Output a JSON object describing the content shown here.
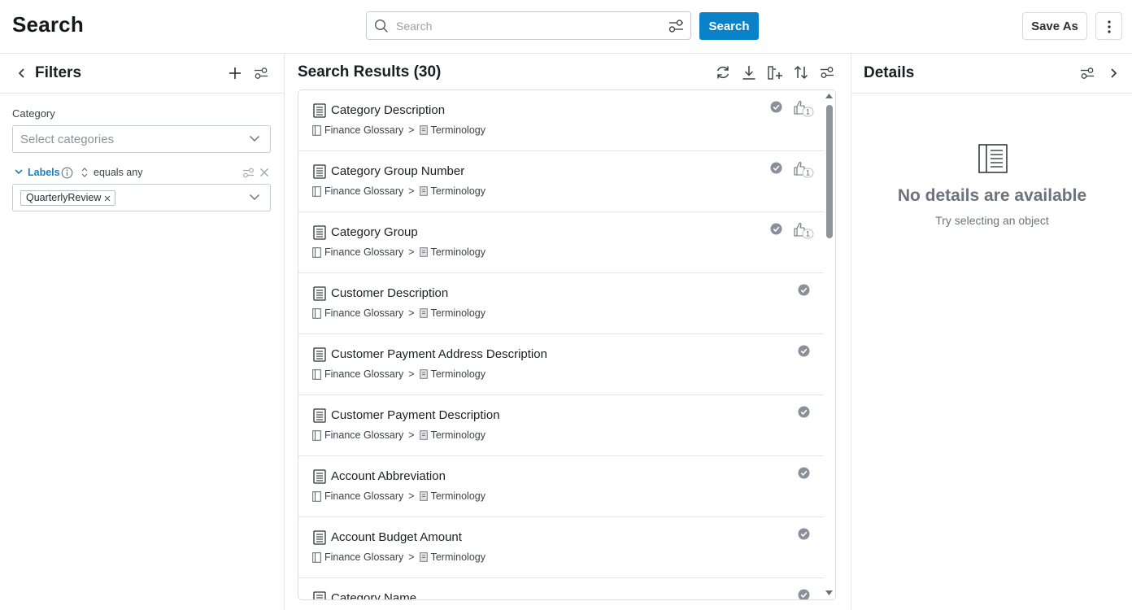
{
  "header": {
    "title": "Search",
    "search": {
      "placeholder": "Search",
      "value": ""
    },
    "search_button": "Search",
    "save_as_button": "Save As"
  },
  "filters": {
    "title": "Filters",
    "category": {
      "label": "Category",
      "placeholder": "Select categories"
    },
    "labels": {
      "label": "Labels",
      "operator": "equals any",
      "chips": [
        "QuarterlyReview"
      ]
    }
  },
  "results": {
    "title": "Search Results (30)",
    "items": [
      {
        "name": "Category Description",
        "glossary": "Finance Glossary",
        "separator": ">",
        "folder": "Terminology",
        "likes": "1"
      },
      {
        "name": "Category Group Number",
        "glossary": "Finance Glossary",
        "separator": ">",
        "folder": "Terminology",
        "likes": "1"
      },
      {
        "name": "Category Group",
        "glossary": "Finance Glossary",
        "separator": ">",
        "folder": "Terminology",
        "likes": "1"
      },
      {
        "name": "Customer Description",
        "glossary": "Finance Glossary",
        "separator": ">",
        "folder": "Terminology",
        "likes": ""
      },
      {
        "name": "Customer Payment Address Description",
        "glossary": "Finance Glossary",
        "separator": ">",
        "folder": "Terminology",
        "likes": ""
      },
      {
        "name": "Customer Payment Description",
        "glossary": "Finance Glossary",
        "separator": ">",
        "folder": "Terminology",
        "likes": ""
      },
      {
        "name": "Account Abbreviation",
        "glossary": "Finance Glossary",
        "separator": ">",
        "folder": "Terminology",
        "likes": ""
      },
      {
        "name": "Account Budget Amount",
        "glossary": "Finance Glossary",
        "separator": ">",
        "folder": "Terminology",
        "likes": ""
      },
      {
        "name": "Category Name",
        "glossary": "",
        "separator": "",
        "folder": "",
        "likes": ""
      }
    ]
  },
  "details": {
    "title": "Details",
    "empty_title": "No details are available",
    "empty_subtitle": "Try selecting an object"
  },
  "colors": {
    "accent": "#0a82c8",
    "verified": "#8a9099",
    "border": "#e4e6ea"
  }
}
